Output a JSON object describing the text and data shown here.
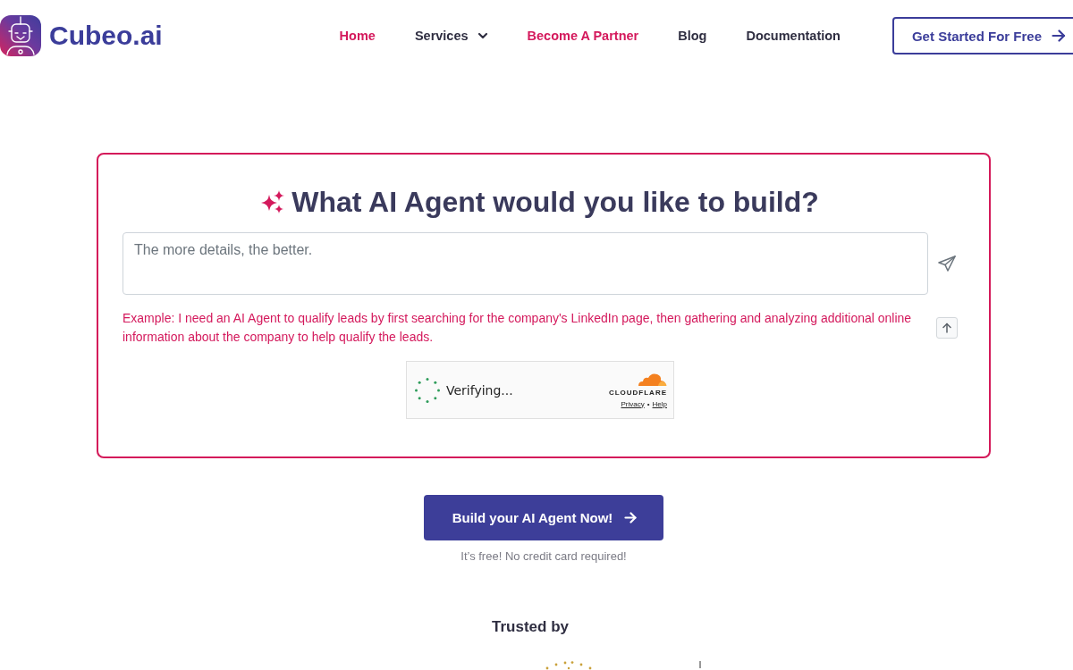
{
  "header": {
    "logo": {
      "text": "Cubeo.ai"
    },
    "nav": [
      {
        "label": "Home",
        "kind": "link",
        "color": "#d4195c"
      },
      {
        "label": "Services",
        "kind": "dropdown",
        "color": "#2f2e41"
      },
      {
        "label": "Become A Partner",
        "kind": "link",
        "color": "#d4195c"
      },
      {
        "label": "Blog",
        "kind": "link",
        "color": "#2f2e41"
      },
      {
        "label": "Documentation",
        "kind": "link",
        "color": "#2f2e41"
      }
    ],
    "cta": {
      "label": "Get Started For Free"
    }
  },
  "builder": {
    "title": "What AI Agent would you like to build?",
    "prompt": {
      "placeholder": "The more details, the better."
    },
    "example": "Example: I need an AI Agent to qualify leads by first searching for the company's LinkedIn page, then gathering and analyzing additional online information about the company to help qualify the leads.",
    "captcha": {
      "status": "Verifying...",
      "brand": "CLOUDFLARE",
      "links": [
        "Privacy",
        "Help"
      ],
      "separator": "•"
    }
  },
  "action": {
    "label": "Build your AI Agent Now!",
    "note": "It’s free! No credit card required!"
  },
  "trusted": {
    "title": "Trusted by"
  }
}
